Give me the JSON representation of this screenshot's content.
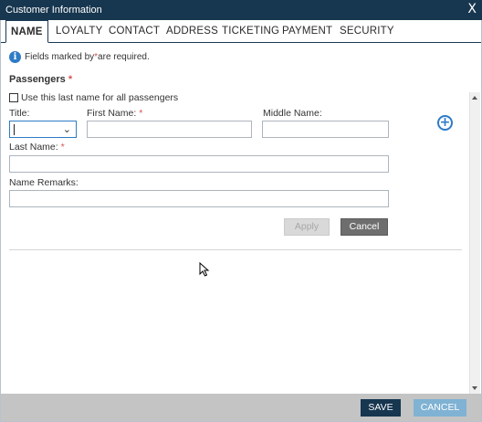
{
  "window": {
    "title": "Customer Information",
    "close_glyph": "X"
  },
  "tabs": [
    {
      "label": "NAME",
      "active": true
    },
    {
      "label": "LOYALTY",
      "active": false
    },
    {
      "label": "CONTACT",
      "active": false
    },
    {
      "label": "ADDRESS",
      "active": false
    },
    {
      "label": "TICKETING",
      "active": false
    },
    {
      "label": "PAYMENT",
      "active": false
    },
    {
      "label": "SECURITY",
      "active": false
    }
  ],
  "info": {
    "icon": "info-icon",
    "glyph": "i",
    "text_before": "Fields marked by ",
    "asterisk": "*",
    "text_after": " are required."
  },
  "passengers": {
    "title": "Passengers",
    "asterisk": "*",
    "use_last_name_label": "Use this last name for all passengers",
    "use_last_name_checked": false,
    "title_label": "Title:",
    "title_value": "",
    "first_name_label": "First Name:",
    "first_name_value": "",
    "middle_name_label": "Middle Name:",
    "middle_name_value": "",
    "last_name_label": "Last Name:",
    "last_name_value": "",
    "name_remarks_label": "Name Remarks:",
    "name_remarks_value": "",
    "apply_label": "Apply",
    "cancel_label": "Cancel",
    "add_glyph": "+"
  },
  "footer": {
    "save_label": "SAVE",
    "cancel_label": "CANCEL"
  },
  "colors": {
    "titlebar": "#17364f",
    "accent": "#2e7bc6",
    "required": "#d9534f",
    "footer_bg": "#c4c4c4",
    "cancel_footer": "#7fb2d3"
  }
}
